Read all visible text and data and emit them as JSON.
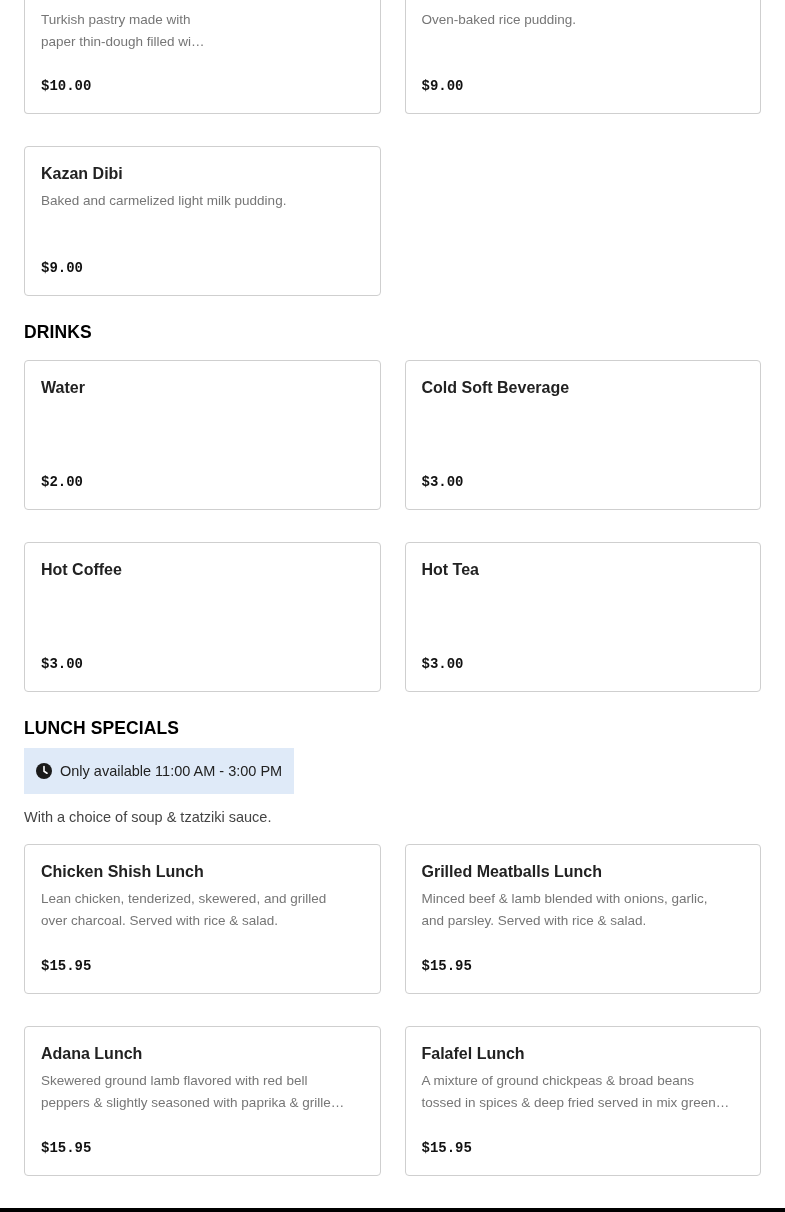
{
  "sections": [
    {
      "items": [
        {
          "description": "Turkish pastry made with\npaper thin-dough filled wi…",
          "price": "$10.00"
        },
        {
          "description": "Oven-baked rice pudding.",
          "price": "$9.00"
        },
        {
          "name": "Kazan Dibi",
          "description": "Baked and carmelized light milk pudding.",
          "price": "$9.00"
        }
      ]
    },
    {
      "title": "DRINKS",
      "items": [
        {
          "name": "Water",
          "price": "$2.00"
        },
        {
          "name": "Cold Soft Beverage",
          "price": "$3.00"
        },
        {
          "name": "Hot Coffee",
          "price": "$3.00"
        },
        {
          "name": "Hot Tea",
          "price": "$3.00"
        }
      ]
    },
    {
      "title": "LUNCH SPECIALS",
      "notice": "Only available 11:00 AM - 3:00 PM",
      "note": "With a choice of soup & tzatziki sauce.",
      "items": [
        {
          "name": "Chicken Shish Lunch",
          "description": "Lean chicken, tenderized, skewered, and grilled\nover charcoal. Served with rice & salad.",
          "price": "$15.95"
        },
        {
          "name": "Grilled Meatballs Lunch",
          "description": "Minced beef & lamb blended with onions, garlic,\nand parsley. Served with rice & salad.",
          "price": "$15.95"
        },
        {
          "name": "Adana Lunch",
          "description": "Skewered ground lamb flavored with red bell\npeppers & slightly seasoned with paprika & grille…",
          "price": "$15.95"
        },
        {
          "name": "Falafel Lunch",
          "description": "A mixture of ground chickpeas & broad beans\ntossed in spices & deep fried served in mix green…",
          "price": "$15.95"
        }
      ]
    }
  ]
}
